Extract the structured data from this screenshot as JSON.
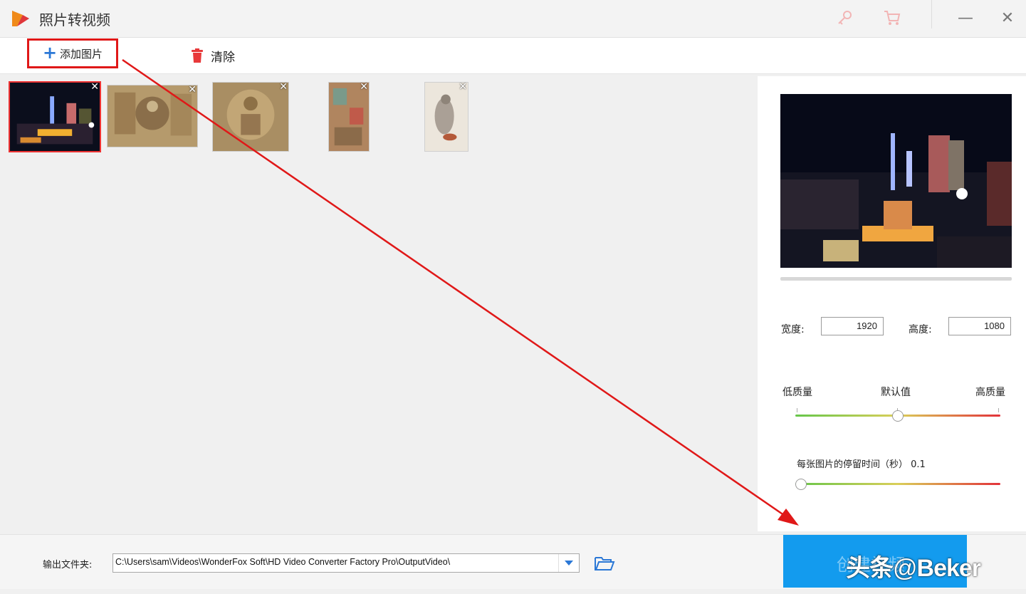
{
  "window": {
    "title": "照片转视频",
    "icons": [
      "app-logo",
      "key-icon",
      "cart-icon",
      "minimize-icon",
      "close-icon"
    ],
    "minimize_glyph": "—",
    "close_glyph": "✕"
  },
  "toolbar": {
    "add_label": "添加图片",
    "clear_label": "清除"
  },
  "thumbnails": [
    {
      "name": "city-night",
      "selected": true
    },
    {
      "name": "mural-1",
      "selected": false
    },
    {
      "name": "mural-2",
      "selected": false
    },
    {
      "name": "mural-3",
      "selected": false
    },
    {
      "name": "sketch",
      "selected": false
    }
  ],
  "thumb_close_glyph": "✕",
  "panel": {
    "width_label": "宽度:",
    "width_value": "1920",
    "height_label": "高度:",
    "height_value": "1080",
    "low_quality": "低质量",
    "default_quality": "默认值",
    "high_quality": "高质量",
    "quality_level": 0.5,
    "duration_label": "每张图片的停留时间（秒）  0.1",
    "duration_level": 0.0
  },
  "output": {
    "label": "输出文件夹:",
    "path": "C:\\Users\\sam\\Videos\\WonderFox Soft\\HD Video Converter Factory Pro\\OutputVideo\\"
  },
  "create_button": {
    "label": "创建视频"
  },
  "watermark": {
    "prefix": "头条",
    "at": "@",
    "name": "Beker"
  },
  "colors": {
    "accent_blue": "#139bee",
    "annotation_red": "#e01818",
    "trash_red": "#e8393a"
  }
}
